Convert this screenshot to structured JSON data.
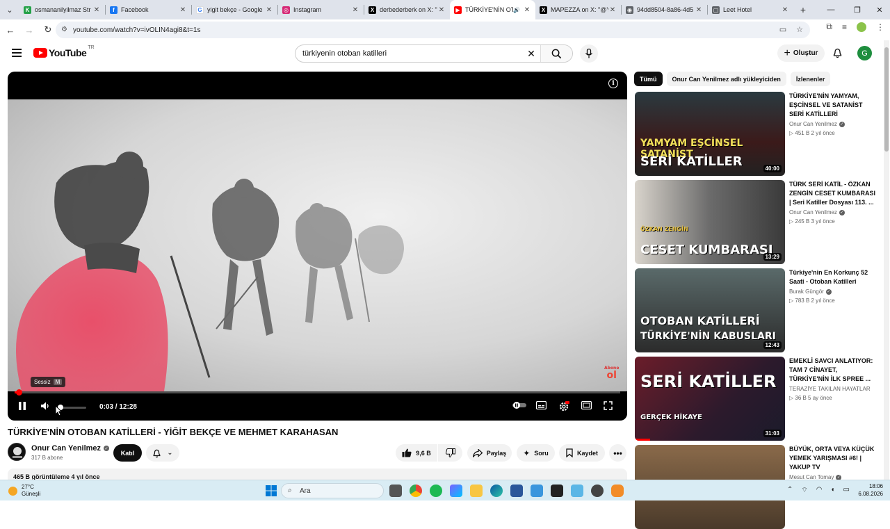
{
  "browser": {
    "tabs": [
      {
        "label": "osmananilyilmaz Str",
        "favicon_color": "#24a148",
        "favicon_glyph": "K"
      },
      {
        "label": "Facebook",
        "favicon_color": "#1877f2",
        "favicon_glyph": "f"
      },
      {
        "label": "yigit bekçe - Google",
        "favicon_color": "#ffffff",
        "favicon_glyph": "G"
      },
      {
        "label": "Instagram",
        "favicon_color": "#d62976",
        "favicon_glyph": "◎"
      },
      {
        "label": "derbederberk on X: \"",
        "favicon_color": "#000000",
        "favicon_glyph": "X"
      },
      {
        "label": "TÜRKİYE'NİN OTO",
        "favicon_color": "#ff0000",
        "favicon_glyph": "▶",
        "active": true
      },
      {
        "label": "MAPEZZA on X: \"@Y",
        "favicon_color": "#000000",
        "favicon_glyph": "X"
      },
      {
        "label": "94dd8504-8a86-4d5",
        "favicon_color": "#5f6368",
        "favicon_glyph": "◉"
      },
      {
        "label": "Leet Hotel",
        "favicon_color": "#5f6368",
        "favicon_glyph": "▢"
      }
    ],
    "url": "youtube.com/watch?v=ivOLIN4agi8&t=1s"
  },
  "header": {
    "logo_text": "YouTube",
    "logo_country": "TR",
    "search_query": "türkiyenin otoban katilleri",
    "create_label": "Oluştur",
    "avatar_letter": "G"
  },
  "player": {
    "current_time": "0:03",
    "duration": "12:28",
    "progress_fraction": 0.004,
    "tooltip_label": "Sessiz",
    "tooltip_key": "M",
    "watermark_top": "Abone",
    "watermark_bottom": "ol"
  },
  "video": {
    "title": "TÜRKİYE'NİN OTOBAN KATİLLERİ - YİĞİT BEKÇE VE MEHMET KARAHASAN",
    "channel": "Onur Can Yenilmez",
    "subscribers": "317 B abone",
    "join_label": "Katıl",
    "likes": "9,6 B",
    "share_label": "Paylaş",
    "ask_label": "Soru",
    "save_label": "Kaydet",
    "views_line": "465 B görüntüleme  4 yıl önce"
  },
  "sidebar": {
    "chips": [
      "Tümü",
      "Onur Can Yenilmez adlı yükleyiciden",
      "İzlenenler"
    ],
    "recommendations": [
      {
        "title": "TÜRKİYE'NİN YAMYAM, EŞCİNSEL VE SATANİST SERİ KATİLLERİ",
        "channel": "Onur Can Yenilmez",
        "stats": "▷ 451 B   2 yıl önce",
        "duration": "40:00",
        "thumb_line1": "YAMYAM EŞCİNSEL SATANİST",
        "thumb_line2": "SERİ KATİLLER",
        "progress": 0
      },
      {
        "title": "TÜRK SERİ KATİL - ÖZKAN ZENGİN CESET KUMBARASI | Seri Katiller Dosyası 113. ...",
        "channel": "Onur Can Yenilmez",
        "stats": "▷ 245 B   3 yıl önce",
        "duration": "13:29",
        "thumb_line1": "ÖZKAN ZENGİN",
        "thumb_line2": "CESET KUMBARASI",
        "progress": 0
      },
      {
        "title": "Türkiye'nin En Korkunç 52 Saati - Otoban Katilleri",
        "channel": "Burak Güngör",
        "stats": "▷ 783 B   2 yıl önce",
        "duration": "12:43",
        "thumb_line1": "OTOBAN KATİLLERİ",
        "thumb_line2": "TÜRKİYE'NİN KABUSLARI",
        "progress": 0
      },
      {
        "title": "EMEKLİ SAVCI ANLATIYOR: TAM 7 CİNAYET, TÜRKİYE'NİN İLK SPREE ...",
        "channel": "TERAZİYE TAKILAN HAYATLAR",
        "stats": "▷ 36 B   5 ay önce",
        "duration": "31:03",
        "thumb_line1": "SERİ KATİLLER",
        "thumb_line2": "GERÇEK HİKAYE",
        "progress": 0.1
      },
      {
        "title": "BÜYÜK, ORTA VEYA KÜÇÜK YEMEK YARIŞMASI #6! | YAKUP TV",
        "channel": "Mesut Can Tomay",
        "stats": "",
        "duration": "",
        "thumb_line1": "",
        "thumb_line2": "",
        "progress": 0
      }
    ]
  },
  "taskbar": {
    "temperature": "27°C",
    "weather": "Güneşli",
    "search_placeholder": "Ara",
    "time": "18:06",
    "date": "6.08.2026"
  }
}
